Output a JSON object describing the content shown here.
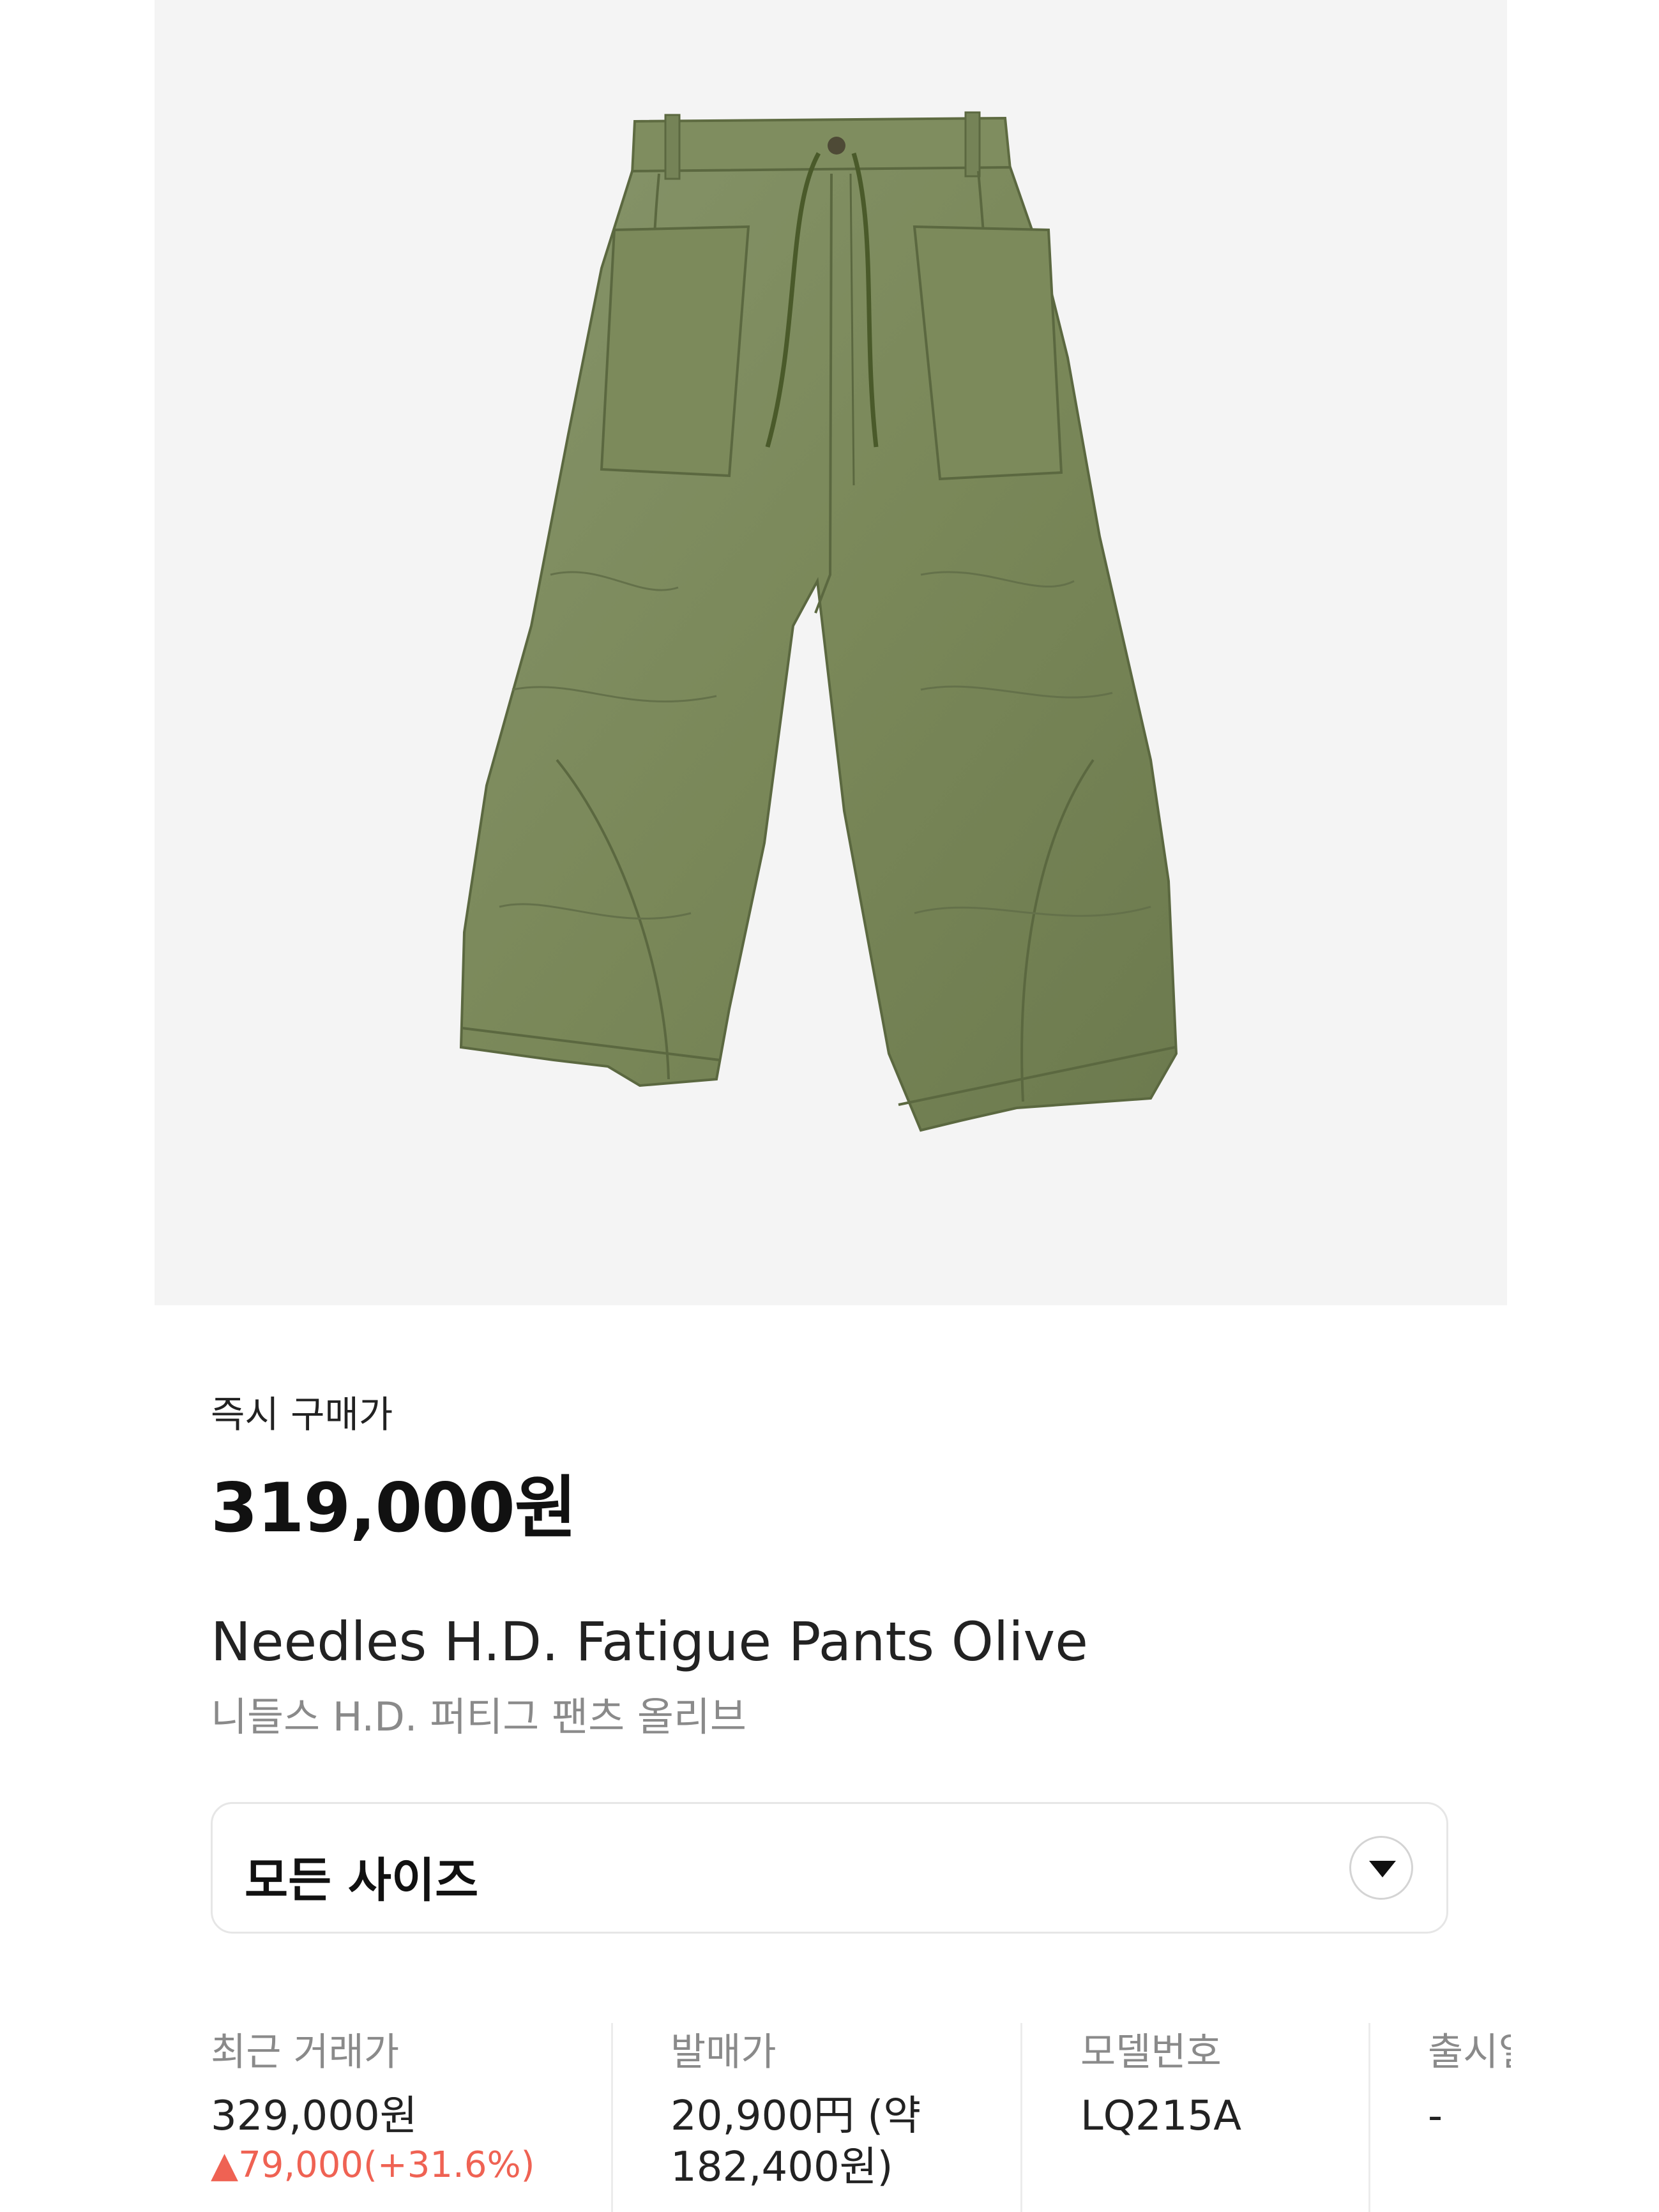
{
  "product": {
    "image_alt": "olive fatigue pants",
    "image_background": "#f4f4f4",
    "fabric_color": "#7b8a5c"
  },
  "price": {
    "label": "즉시 구매가",
    "value": "319,000원"
  },
  "name": {
    "english": "Needles H.D. Fatigue Pants Olive",
    "korean": "니들스 H.D. 퍼티그 팬츠 올리브"
  },
  "size_selector": {
    "label": "모든 사이즈",
    "icon": "chevron-down-icon"
  },
  "details": {
    "recent_trade": {
      "label": "최근 거래가",
      "value": "329,000원",
      "change": "▲79,000(+31.6%)",
      "change_color": "#ef6253"
    },
    "release_price": {
      "label": "발매가",
      "value_line1": "20,900円 (약",
      "value_line2": "182,400원)"
    },
    "model_number": {
      "label": "모델번호",
      "value": "LQ215A"
    },
    "release_date": {
      "label": "출시일",
      "value": "-"
    }
  }
}
